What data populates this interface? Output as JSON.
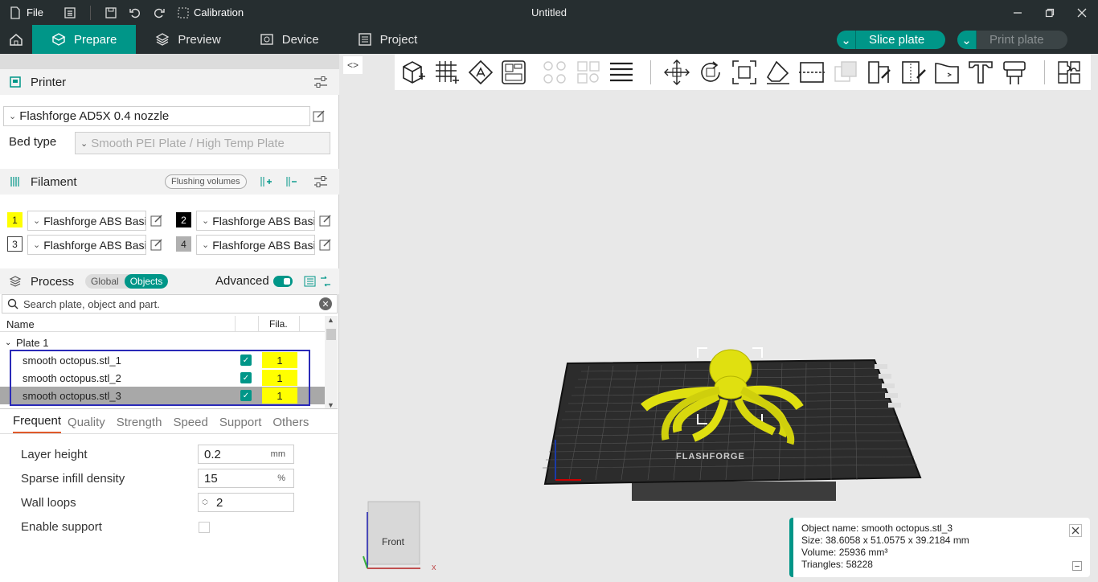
{
  "titlebar": {
    "file_label": "File",
    "calibration_label": "Calibration",
    "window_title": "Untitled"
  },
  "tabs": {
    "prepare": "Prepare",
    "preview": "Preview",
    "device": "Device",
    "project": "Project"
  },
  "actions": {
    "slice": "Slice plate",
    "print": "Print plate"
  },
  "printer": {
    "section_title": "Printer",
    "preset": "Flashforge AD5X 0.4 nozzle",
    "bed_label": "Bed type",
    "bed_value": "Smooth PEI Plate / High Temp Plate"
  },
  "filament": {
    "section_title": "Filament",
    "flushing_label": "Flushing volumes",
    "items": [
      {
        "num": "1",
        "name": "Flashforge ABS Basic",
        "color": "#ffff00"
      },
      {
        "num": "2",
        "name": "Flashforge ABS Basic",
        "color": "#000000"
      },
      {
        "num": "3",
        "name": "Flashforge ABS Basic",
        "color": "#ffffff"
      },
      {
        "num": "4",
        "name": "Flashforge ABS Basic",
        "color": "#b0b0b0"
      }
    ]
  },
  "process": {
    "section_title": "Process",
    "global_label": "Global",
    "objects_label": "Objects",
    "advanced_label": "Advanced"
  },
  "search": {
    "placeholder": "Search plate, object and part."
  },
  "object_list": {
    "col_name": "Name",
    "col_fila": "Fila.",
    "plate_label": "Plate 1",
    "objects": [
      {
        "name": "smooth octopus.stl_1",
        "fila": "1"
      },
      {
        "name": "smooth octopus.stl_2",
        "fila": "1"
      },
      {
        "name": "smooth octopus.stl_3",
        "fila": "1"
      }
    ]
  },
  "settings_tabs": [
    "Frequent",
    "Quality",
    "Strength",
    "Speed",
    "Support",
    "Others"
  ],
  "params": {
    "layer_height_label": "Layer height",
    "layer_height_value": "0.2",
    "layer_height_unit": "mm",
    "infill_label": "Sparse infill density",
    "infill_value": "15",
    "infill_unit": "%",
    "wall_label": "Wall loops",
    "wall_value": "2",
    "support_label": "Enable support"
  },
  "viewport": {
    "brand_text": "FLASHFORGE",
    "cube_face": "Front",
    "axis_x": "x"
  },
  "info": {
    "name": "Object name: smooth octopus.stl_3",
    "size": "Size: 38.6058 x 51.0575 x 39.2184 mm",
    "volume": "Volume: 25936 mm³",
    "triangles": "Triangles: 58228"
  },
  "colors": {
    "accent": "#009688",
    "titlebar": "#262e30",
    "selection_box": "#2a2ab8",
    "model": "#e0e010"
  }
}
